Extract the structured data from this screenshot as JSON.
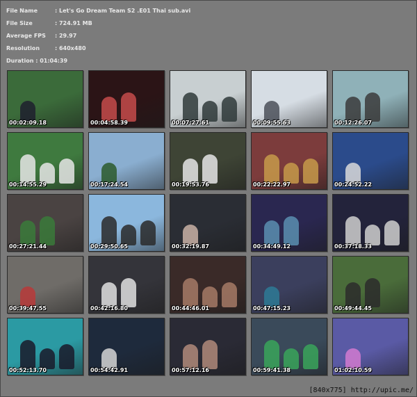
{
  "file_info": {
    "file_name_label": "File Name",
    "file_name_value": ": Let's Go Dream Team S2 .E01 Thai sub.avi",
    "file_size_label": "File Size",
    "file_size_value": ": 724.91 MB",
    "fps_label": "Average FPS",
    "fps_value": ": 29.97",
    "resolution_label": "Resolution",
    "resolution_value": ": 640x480",
    "duration_text": "Duration : 01:04:39"
  },
  "thumbnails": [
    {
      "time": "00:02:09.18",
      "bg": "#3b6b3a",
      "fg": "#1e1e2e"
    },
    {
      "time": "00:04:58.39",
      "bg": "#2b1416",
      "fg": "#c64b4b"
    },
    {
      "time": "00:07:27.61",
      "bg": "#c8cfd1",
      "fg": "#2f3a3a"
    },
    {
      "time": "00:09:55.63",
      "bg": "#d6dde4",
      "fg": "#4b5059"
    },
    {
      "time": "00:12:26.07",
      "bg": "#8fb1b8",
      "fg": "#3b3b3b"
    },
    {
      "time": "00:14:55.29",
      "bg": "#3f7a3f",
      "fg": "#e6e6e6"
    },
    {
      "time": "00:17:24.54",
      "bg": "#8aaed0",
      "fg": "#2c5a2c"
    },
    {
      "time": "00:19:53.76",
      "bg": "#3e4435",
      "fg": "#e5e5e5"
    },
    {
      "time": "00:22:22.97",
      "bg": "#7c3c3c",
      "fg": "#c79a4a"
    },
    {
      "time": "00:24:52.22",
      "bg": "#2b4b8b",
      "fg": "#d9d9d9"
    },
    {
      "time": "00:27:21.44",
      "bg": "#4a4342",
      "fg": "#3a7a3a"
    },
    {
      "time": "00:29:50.65",
      "bg": "#8bb7dd",
      "fg": "#2a2a2a"
    },
    {
      "time": "00:32:19.87",
      "bg": "#2a2d34",
      "fg": "#c9b2a6"
    },
    {
      "time": "00:34:49.12",
      "bg": "#2a2750",
      "fg": "#5a8fb0"
    },
    {
      "time": "00:37:18.33",
      "bg": "#23233b",
      "fg": "#cfcfcf"
    },
    {
      "time": "00:39:47.55",
      "bg": "#6f6c68",
      "fg": "#b93a3a"
    },
    {
      "time": "00:42:16.80",
      "bg": "#34343a",
      "fg": "#e0e0e0"
    },
    {
      "time": "00:44:46.01",
      "bg": "#3a2a28",
      "fg": "#a67a66"
    },
    {
      "time": "00:47:15.23",
      "bg": "#3b3f5d",
      "fg": "#2e7a95"
    },
    {
      "time": "00:49:44.45",
      "bg": "#4a6c3a",
      "fg": "#2c2c2c"
    },
    {
      "time": "00:52:13.70",
      "bg": "#2b9aa3",
      "fg": "#1a1a2a"
    },
    {
      "time": "00:54:42.91",
      "bg": "#1e2a3c",
      "fg": "#d5d5d5"
    },
    {
      "time": "00:57:12.16",
      "bg": "#2a2a35",
      "fg": "#b08a7a"
    },
    {
      "time": "00:59:41.38",
      "bg": "#3a4a5a",
      "fg": "#3aa55a"
    },
    {
      "time": "01:02:10.59",
      "bg": "#5a5aa5",
      "fg": "#d27ad0"
    }
  ],
  "watermark_text": "[840x775] http://upic.me/"
}
